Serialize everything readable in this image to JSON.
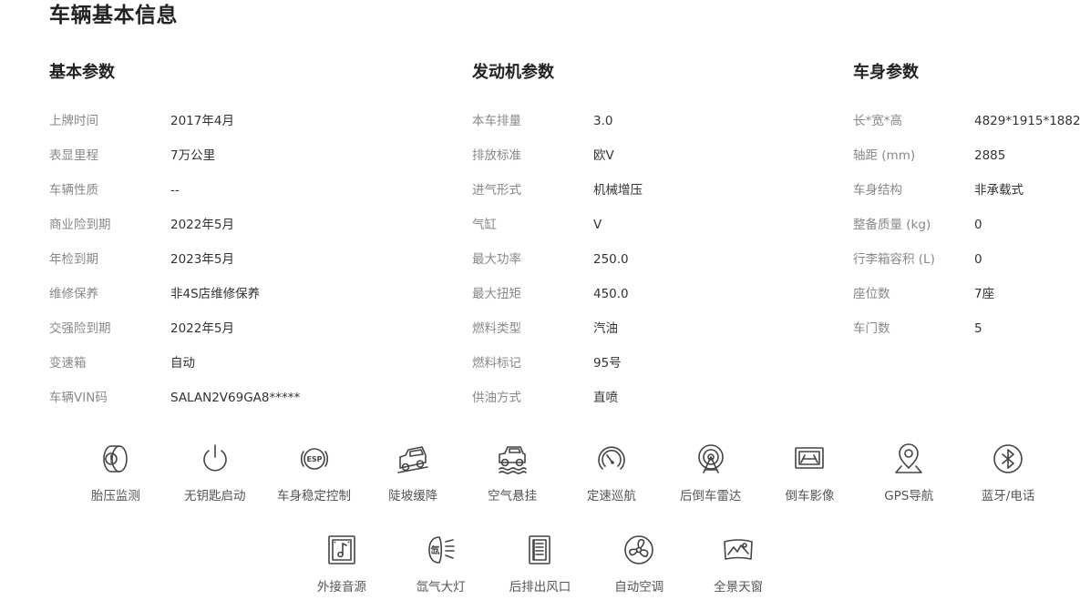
{
  "page_title": "车辆基本信息",
  "sections": {
    "basic": {
      "title": "基本参数",
      "rows": [
        {
          "label": "上牌时间",
          "value": "2017年4月"
        },
        {
          "label": "表显里程",
          "value": "7万公里"
        },
        {
          "label": "车辆性质",
          "value": "--"
        },
        {
          "label": "商业险到期",
          "value": "2022年5月"
        },
        {
          "label": "年检到期",
          "value": "2023年5月"
        },
        {
          "label": "维修保养",
          "value": "非4S店维修保养"
        },
        {
          "label": "交强险到期",
          "value": "2022年5月"
        },
        {
          "label": "变速箱",
          "value": "自动"
        },
        {
          "label": "车辆VIN码",
          "value": "SALAN2V69GA8*****"
        }
      ]
    },
    "engine": {
      "title": "发动机参数",
      "rows": [
        {
          "label": "本车排量",
          "value": "3.0"
        },
        {
          "label": "排放标准",
          "value": "欧V"
        },
        {
          "label": "进气形式",
          "value": "机械增压"
        },
        {
          "label": "气缸",
          "value": "V"
        },
        {
          "label": "最大功率",
          "value": "250.0"
        },
        {
          "label": "最大扭矩",
          "value": "450.0"
        },
        {
          "label": "燃料类型",
          "value": "汽油"
        },
        {
          "label": "燃料标记",
          "value": "95号"
        },
        {
          "label": "供油方式",
          "value": "直喷"
        }
      ]
    },
    "body": {
      "title": "车身参数",
      "rows": [
        {
          "label": "长*宽*高",
          "value": "4829*1915*1882"
        },
        {
          "label": "轴距 (mm)",
          "value": "2885"
        },
        {
          "label": "车身结构",
          "value": "非承载式"
        },
        {
          "label": "整备质量 (kg)",
          "value": "0"
        },
        {
          "label": "行李箱容积 (L)",
          "value": "0"
        },
        {
          "label": "座位数",
          "value": "7座"
        },
        {
          "label": "车门数",
          "value": "5"
        }
      ]
    }
  },
  "features_row1": [
    {
      "label": "胎压监测",
      "icon": "tire-pressure-icon"
    },
    {
      "label": "无钥匙启动",
      "icon": "power-icon"
    },
    {
      "label": "车身稳定控制",
      "icon": "esp-icon"
    },
    {
      "label": "陡坡缓降",
      "icon": "hill-descent-icon"
    },
    {
      "label": "空气悬挂",
      "icon": "air-suspension-icon"
    },
    {
      "label": "定速巡航",
      "icon": "cruise-control-icon"
    },
    {
      "label": "后倒车雷达",
      "icon": "parking-radar-icon"
    },
    {
      "label": "倒车影像",
      "icon": "reverse-camera-icon"
    },
    {
      "label": "GPS导航",
      "icon": "gps-pin-icon"
    },
    {
      "label": "蓝牙/电话",
      "icon": "bluetooth-icon"
    }
  ],
  "features_row2": [
    {
      "label": "外接音源",
      "icon": "music-note-icon"
    },
    {
      "label": "氙气大灯",
      "icon": "xenon-headlight-icon"
    },
    {
      "label": "后排出风口",
      "icon": "rear-air-vent-icon"
    },
    {
      "label": "自动空调",
      "icon": "fan-icon"
    },
    {
      "label": "全景天窗",
      "icon": "panoramic-sunroof-icon"
    }
  ],
  "icon_text": {
    "esp": "ESP",
    "xenon": "氙"
  }
}
